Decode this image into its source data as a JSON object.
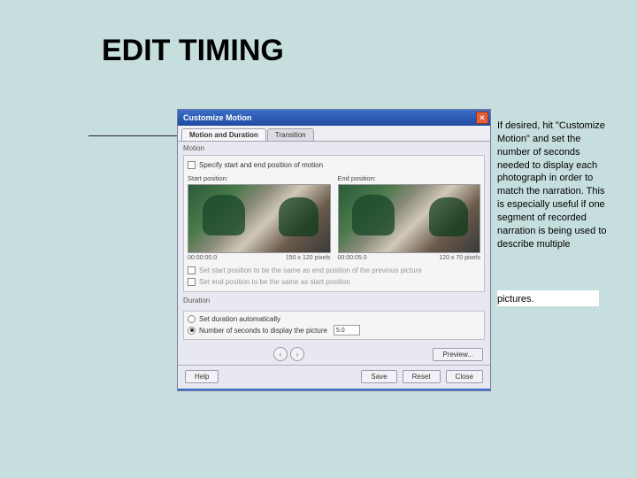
{
  "page": {
    "title": "EDIT TIMING",
    "sidebar_text": "If desired, hit \"Customize Motion\" and set the number of seconds needed to display each photograph in order to match the narration. This is especially useful if one segment of recorded narration is being used to describe multiple",
    "pictures_label": "pictures."
  },
  "dialog": {
    "title": "Customize Motion",
    "tabs": {
      "motion_duration": "Motion and Duration",
      "transition": "Transition"
    },
    "motion_section": "Motion",
    "specify_checkbox": "Specify start and end position of motion",
    "start_pos_label": "Start position:",
    "end_pos_label": "End position:",
    "thumb1_time": "00:00:00.0",
    "thumb1_dims": "150 x 120 pixels",
    "thumb2_time": "00:00:05.0",
    "thumb2_dims": "120 x 70 pixels",
    "start_same_checkbox": "Set start position to be the same as end position of the previous picture",
    "end_same_checkbox": "Set end position to be the same as start position",
    "duration_section": "Duration",
    "set_auto_radio": "Set duration automatically",
    "num_seconds_radio": "Number of seconds to display the picture",
    "num_seconds_value": "5.0",
    "preview_btn": "Preview...",
    "help_btn": "Help",
    "save_btn": "Save",
    "reset_btn": "Reset",
    "close_btn": "Close"
  }
}
